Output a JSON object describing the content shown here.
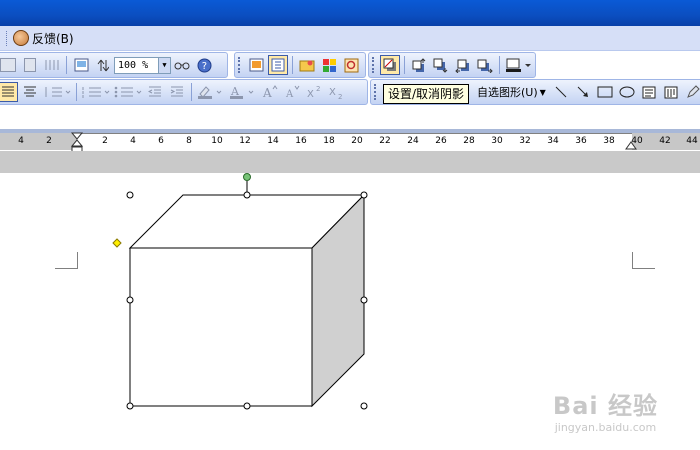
{
  "menu": {
    "feedback": "反馈(B)"
  },
  "toolbar": {
    "zoom_value": "100 %"
  },
  "tooltip": {
    "text": "设置/取消阴影"
  },
  "drawing_toolbar": {
    "autoshapes": "自选图形(U)"
  },
  "ruler": {
    "labels": [
      "4",
      "2",
      "2",
      "4",
      "6",
      "8",
      "10",
      "12",
      "14",
      "16",
      "18",
      "20",
      "22",
      "24",
      "26",
      "28",
      "30",
      "32",
      "34",
      "36",
      "38",
      "40",
      "42",
      "44"
    ]
  },
  "watermark": {
    "brand": "Bai 经验",
    "url": "jingyan.baidu.com"
  },
  "colors": {
    "titlebar": "#0b4ec0",
    "toolbar": "#c4d3f3",
    "cube_side": "#d0d0d0",
    "handle_green": "#77c377",
    "handle_yellow": "#ffee00"
  }
}
